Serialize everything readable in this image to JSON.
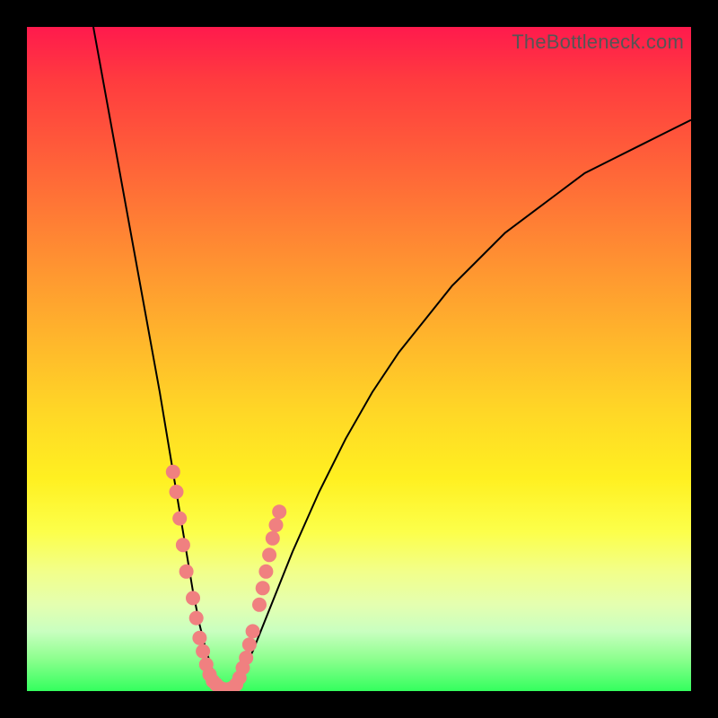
{
  "watermark": "TheBottleneck.com",
  "colors": {
    "frame": "#000000",
    "curve": "#000000",
    "marker": "#f08080",
    "gradient_top": "#ff1a4d",
    "gradient_bottom": "#34ff5e"
  },
  "chart_data": {
    "type": "line",
    "title": "",
    "xlabel": "",
    "ylabel": "",
    "xlim": [
      0,
      100
    ],
    "ylim": [
      0,
      100
    ],
    "grid": false,
    "series": [
      {
        "name": "bottleneck-curve",
        "x": [
          10,
          12,
          14,
          16,
          18,
          20,
          21,
          22,
          23,
          24,
          25,
          26,
          27,
          28,
          29,
          30,
          32,
          34,
          36,
          38,
          40,
          44,
          48,
          52,
          56,
          60,
          64,
          68,
          72,
          76,
          80,
          84,
          88,
          92,
          96,
          100
        ],
        "y": [
          100,
          89,
          78,
          67,
          56,
          45,
          39,
          33,
          27,
          21,
          15,
          10,
          6,
          3,
          1,
          0,
          2,
          6,
          11,
          16,
          21,
          30,
          38,
          45,
          51,
          56,
          61,
          65,
          69,
          72,
          75,
          78,
          80,
          82,
          84,
          86
        ]
      }
    ],
    "markers": [
      {
        "x": 22,
        "y": 33
      },
      {
        "x": 22.5,
        "y": 30
      },
      {
        "x": 23,
        "y": 26
      },
      {
        "x": 23.5,
        "y": 22
      },
      {
        "x": 24,
        "y": 18
      },
      {
        "x": 25,
        "y": 14
      },
      {
        "x": 25.5,
        "y": 11
      },
      {
        "x": 26,
        "y": 8
      },
      {
        "x": 26.5,
        "y": 6
      },
      {
        "x": 27,
        "y": 4
      },
      {
        "x": 27.5,
        "y": 2.5
      },
      {
        "x": 28,
        "y": 1.5
      },
      {
        "x": 28.5,
        "y": 1
      },
      {
        "x": 29,
        "y": 0.5
      },
      {
        "x": 29.5,
        "y": 0.3
      },
      {
        "x": 30,
        "y": 0.2
      },
      {
        "x": 30.5,
        "y": 0.3
      },
      {
        "x": 31,
        "y": 0.5
      },
      {
        "x": 31.5,
        "y": 1
      },
      {
        "x": 32,
        "y": 2
      },
      {
        "x": 32.5,
        "y": 3.5
      },
      {
        "x": 33,
        "y": 5
      },
      {
        "x": 33.5,
        "y": 7
      },
      {
        "x": 34,
        "y": 9
      },
      {
        "x": 35,
        "y": 13
      },
      {
        "x": 35.5,
        "y": 15.5
      },
      {
        "x": 36,
        "y": 18
      },
      {
        "x": 36.5,
        "y": 20.5
      },
      {
        "x": 37,
        "y": 23
      },
      {
        "x": 37.5,
        "y": 25
      },
      {
        "x": 38,
        "y": 27
      }
    ]
  }
}
